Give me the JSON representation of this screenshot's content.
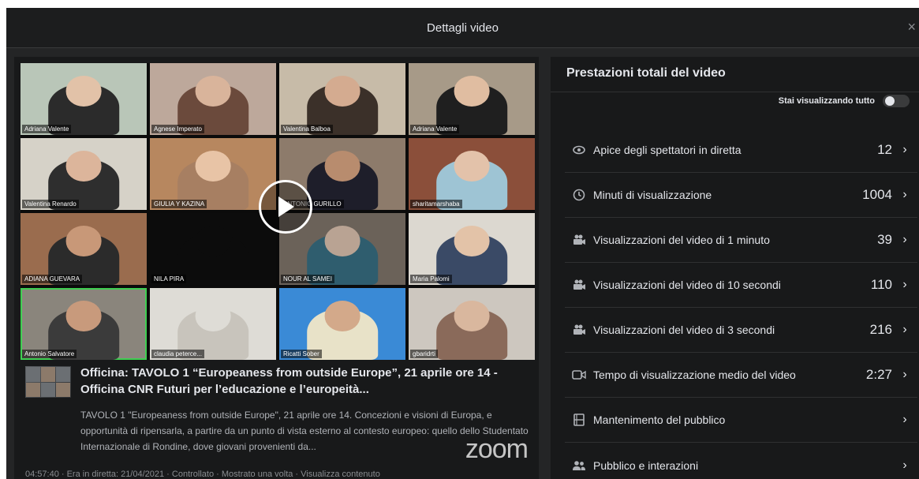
{
  "modal": {
    "title": "Dettagli video",
    "close_glyph": "×"
  },
  "video": {
    "participants": [
      {
        "name": "Adriana Valente",
        "bg": "#b9c6b8",
        "skin": "#e2c2a8",
        "shirt": "#2b2b2b"
      },
      {
        "name": "Agnese Imperato",
        "bg": "#bda89b",
        "skin": "#d9b49b",
        "shirt": "#6b4a3c"
      },
      {
        "name": "Valentina Balboa",
        "bg": "#c7bba8",
        "skin": "#d4ab90",
        "shirt": "#3b3029"
      },
      {
        "name": "Adriana Valente",
        "bg": "#a79a88",
        "skin": "#e0bda1",
        "shirt": "#1f1f1f"
      },
      {
        "name": "Valentina Renardo",
        "bg": "#d6d2c8",
        "skin": "#dcb59b",
        "shirt": "#2e2e2e"
      },
      {
        "name": "GIULIA Y KAZINA",
        "bg": "#b7875f",
        "skin": "#e8c4a6",
        "shirt": "#a77f62"
      },
      {
        "name": "ANTONIO GURILLO",
        "bg": "#8d7b6b",
        "skin": "#b88c6e",
        "shirt": "#1e1e2a"
      },
      {
        "name": "sharitamarshaba",
        "bg": "#8b4f3a",
        "skin": "#e3c2aa",
        "shirt": "#9ec4d4"
      },
      {
        "name": "ADIANA GUEVARA",
        "bg": "#9a6c4e",
        "skin": "#c89878",
        "shirt": "#2b2b2b"
      },
      {
        "name": "NILA PIRA",
        "bg": "#0c0c0c",
        "skin": "#0c0c0c",
        "shirt": "#0c0c0c"
      },
      {
        "name": "NOUR AL SAMEI",
        "bg": "#6b6259",
        "skin": "#b9a393",
        "shirt": "#2f5d6e"
      },
      {
        "name": "Maria Palomi",
        "bg": "#dcd8d0",
        "skin": "#e3c3a8",
        "shirt": "#3a4a66"
      },
      {
        "name": "Antonio Salvatore",
        "bg": "#8a857c",
        "skin": "#c89a7c",
        "shirt": "#3b3b3b"
      },
      {
        "name": "claudia peterce...",
        "bg": "#dedcd6",
        "skin": "#dedcd6",
        "shirt": "#c8c4bc"
      },
      {
        "name": "Ricatti Sober",
        "bg": "#3a8ad6",
        "skin": "#d3a98a",
        "shirt": "#e8e2c8"
      },
      {
        "name": "gbaridrti",
        "bg": "#cdc7bf",
        "skin": "#d9b79e",
        "shirt": "#8a6a5a"
      }
    ],
    "watermark": "zoom"
  },
  "post": {
    "title": "Officina: TAVOLO 1 “Europeaness from outside Europe”, 21 aprile ore 14 - Officina CNR Futuri per l’educazione e l’europeità...",
    "description": "TAVOLO 1 \"Europeaness from outside Europe\", 21 aprile ore 14. Concezioni e visioni di Europa, e opportunità di ripensarla, a partire da un punto di vista esterno al contesto europeo: quello dello Studentato Internazionale di Rondine, dove giovani provenienti da...",
    "meta": "04:57:40  ·  Era in diretta: 21/04/2021  ·  Controllato  ·  Mostrato una volta  ·  Visualizza contenuto"
  },
  "stats": {
    "title": "Prestazioni totali del video",
    "toggle_label": "Stai visualizzando tutto",
    "toggle_on": false,
    "metrics": [
      {
        "icon": "eye-icon",
        "label": "Apice degli spettatori in diretta",
        "value": "12"
      },
      {
        "icon": "clock-icon",
        "label": "Minuti di visualizzazione",
        "value": "1004"
      },
      {
        "icon": "video-views-icon",
        "label": "Visualizzazioni del video di 1 minuto",
        "value": "39"
      },
      {
        "icon": "video-views-icon",
        "label": "Visualizzazioni del video di 10 secondi",
        "value": "110"
      },
      {
        "icon": "video-views-icon",
        "label": "Visualizzazioni del video di 3 secondi",
        "value": "216"
      },
      {
        "icon": "video-camera-icon",
        "label": "Tempo di visualizzazione medio del video",
        "value": "2:27"
      },
      {
        "icon": "film-icon",
        "label": "Mantenimento del pubblico",
        "value": ""
      },
      {
        "icon": "people-icon",
        "label": "Pubblico e interazioni",
        "value": ""
      }
    ]
  },
  "colors": {
    "background": "#242526",
    "panel": "#18191a",
    "text": "#e4e6eb",
    "active_speaker": "#3fcf52"
  }
}
